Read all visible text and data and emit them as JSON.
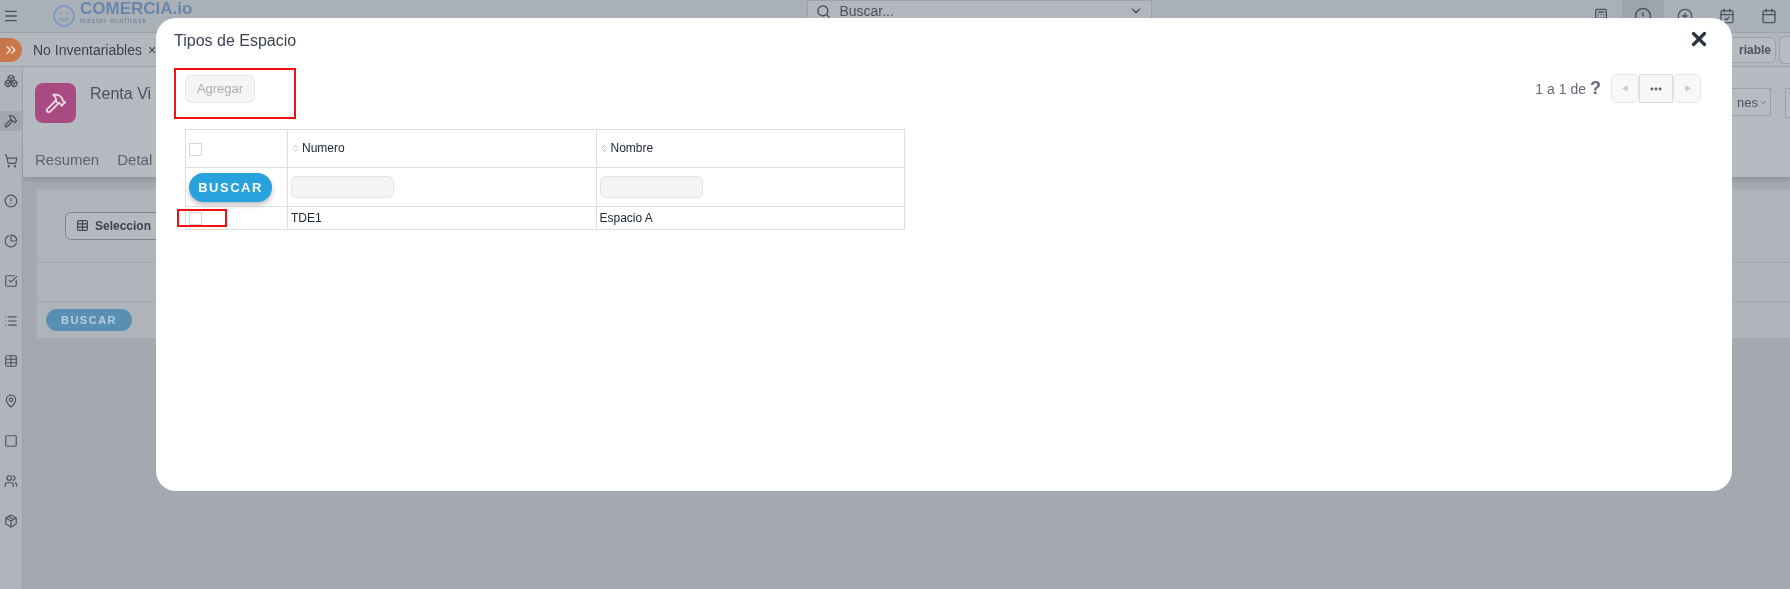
{
  "topbar": {
    "logo": {
      "name": "COMERCIA.io",
      "tagline": "master multitask"
    },
    "search": {
      "placeholder": "Buscar..."
    }
  },
  "breadcrumb": {
    "tab": {
      "label": "No Inventariables",
      "close": "×"
    },
    "button": "riable"
  },
  "record": {
    "title": "Renta Vi",
    "tabs": [
      {
        "label": "Resumen",
        "selected": false
      },
      {
        "label": "Detal",
        "selected": false
      }
    ],
    "select_button": "Seleccion",
    "search_button": "BUSCAR",
    "menu_button": "nes"
  },
  "dialog": {
    "title": "Tipos de Espacio",
    "add_button": {
      "label": "Agregar",
      "disabled": true
    },
    "pagination": {
      "range": "1 a 1",
      "of": "de",
      "total": "?"
    },
    "table": {
      "select_all_checked": false,
      "columns": [
        "Numero",
        "Nombre"
      ],
      "search_button": "BUSCAR",
      "rows": [
        {
          "checked": false,
          "cells": [
            "TDE1",
            "Espacio A"
          ]
        }
      ]
    }
  }
}
